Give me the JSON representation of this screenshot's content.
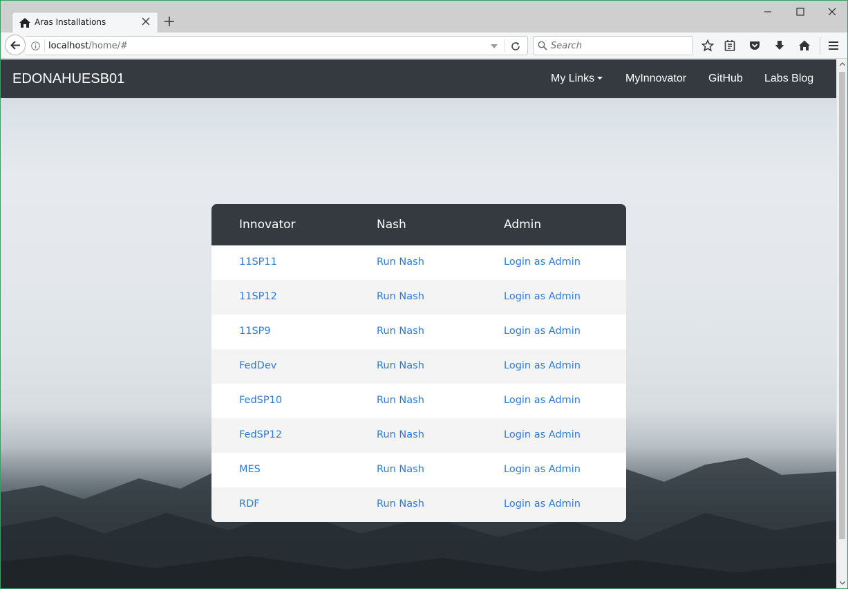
{
  "browser": {
    "tab_title": "Aras Installations",
    "url_host": "localhost",
    "url_path": "/home/#",
    "search_placeholder": "Search"
  },
  "site": {
    "brand": "EDONAHUESB01",
    "nav": {
      "my_links": "My Links",
      "myinnovator": "MyInnovator",
      "github": "GitHub",
      "labs_blog": "Labs Blog"
    }
  },
  "table": {
    "headers": [
      "Innovator",
      "Nash",
      "Admin"
    ],
    "rows": [
      {
        "innovator": "11SP11",
        "nash": "Run Nash",
        "admin": "Login as Admin"
      },
      {
        "innovator": "11SP12",
        "nash": "Run Nash",
        "admin": "Login as Admin"
      },
      {
        "innovator": "11SP9",
        "nash": "Run Nash",
        "admin": "Login as Admin"
      },
      {
        "innovator": "FedDev",
        "nash": "Run Nash",
        "admin": "Login as Admin"
      },
      {
        "innovator": "FedSP10",
        "nash": "Run Nash",
        "admin": "Login as Admin"
      },
      {
        "innovator": "FedSP12",
        "nash": "Run Nash",
        "admin": "Login as Admin"
      },
      {
        "innovator": "MES",
        "nash": "Run Nash",
        "admin": "Login as Admin"
      },
      {
        "innovator": "RDF",
        "nash": "Run Nash",
        "admin": "Login as Admin"
      }
    ]
  },
  "colors": {
    "navbar": "#343a40",
    "link": "#2e7ad6",
    "row_alt": "#f4f4f4"
  }
}
